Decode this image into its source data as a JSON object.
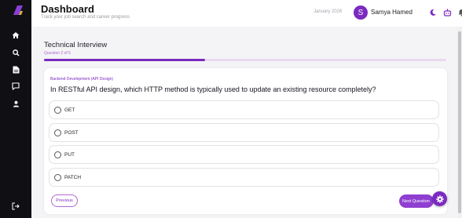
{
  "header": {
    "title": "Dashboard",
    "subtitle": "Track your job search and career progress",
    "date": "January 2026",
    "avatar_initial": "S",
    "user_name": "Samya Hamed"
  },
  "sidebar": {
    "items": [
      {
        "icon": "home-icon"
      },
      {
        "icon": "search-icon"
      },
      {
        "icon": "document-icon"
      },
      {
        "icon": "chat-icon"
      },
      {
        "icon": "user-icon"
      }
    ],
    "logout_icon": "logout-icon"
  },
  "quiz": {
    "title": "Technical Interview",
    "progress_text": "Question 2 of 5",
    "progress_fraction": 0.4,
    "category": "Backend Development (API Design)",
    "question": "In RESTful API design, which HTTP method is typically used to update an existing resource completely?",
    "options": [
      "GET",
      "POST",
      "PUT",
      "PATCH"
    ],
    "previous_label": "Previous",
    "next_label": "Next Question"
  },
  "colors": {
    "accent": "#7b2ac0",
    "sidebar_bg": "#101014"
  }
}
